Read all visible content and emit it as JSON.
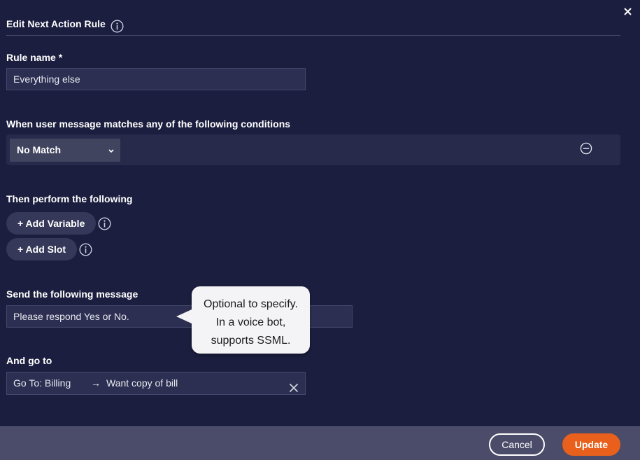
{
  "dialog": {
    "title": "Edit Next Action Rule",
    "close_icon": "close-icon",
    "title_info_icon": "info-icon"
  },
  "rule_name": {
    "label": "Rule name *",
    "value": "Everything else"
  },
  "conditions": {
    "label": "When user message matches any of the following conditions",
    "select_value": "No Match",
    "remove_icon": "minus-circle-icon"
  },
  "actions": {
    "label": "Then perform the following",
    "add_variable": "+ Add Variable",
    "add_slot": "+ Add Slot"
  },
  "message": {
    "label": "Send the following message",
    "value": "Please respond Yes or No."
  },
  "tooltip": {
    "lines": [
      "Optional to specify.",
      "In a voice bot,",
      "supports SSML."
    ]
  },
  "goto": {
    "label": "And go to",
    "target": "Go To: Billing",
    "arrow": "→",
    "destination": "Want copy of bill"
  },
  "footer": {
    "cancel": "Cancel",
    "update": "Update"
  },
  "colors": {
    "background": "#1b1e3e",
    "accent": "#e8601c",
    "footer": "#4a4c69"
  }
}
